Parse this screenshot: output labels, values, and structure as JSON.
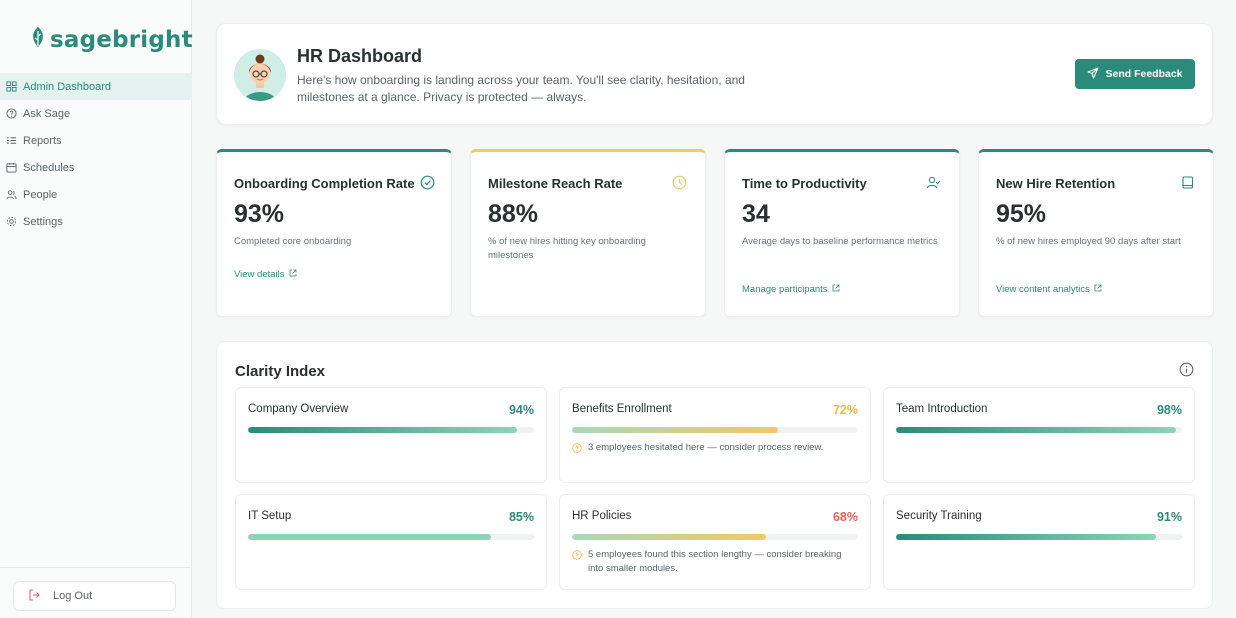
{
  "app": {
    "brand": "sagebright"
  },
  "sidebar": {
    "items": [
      {
        "label": "Admin Dashboard",
        "icon": "grid-icon",
        "active": true
      },
      {
        "label": "Ask Sage",
        "icon": "help-circle-icon",
        "active": false
      },
      {
        "label": "Reports",
        "icon": "list-icon",
        "active": false
      },
      {
        "label": "Schedules",
        "icon": "calendar-icon",
        "active": false
      },
      {
        "label": "People",
        "icon": "users-icon",
        "active": false
      },
      {
        "label": "Settings",
        "icon": "gear-icon",
        "active": false
      }
    ],
    "logout_label": "Log Out"
  },
  "header": {
    "title": "HR Dashboard",
    "subtitle": "Here's how onboarding is landing across your team. You'll see clarity, hesitation, and milestones at a glance. Privacy is protected — always.",
    "feedback_label": "Send Feedback"
  },
  "metrics": [
    {
      "title": "Onboarding Completion Rate",
      "value": "93%",
      "desc": "Completed core onboarding",
      "link": "View details",
      "icon": "check-circle-icon",
      "accent": "#2b8b7a"
    },
    {
      "title": "Milestone Reach Rate",
      "value": "88%",
      "desc": "% of new hires hitting key onboarding milestones",
      "link": "",
      "icon": "clock-icon",
      "accent": "#f3c867"
    },
    {
      "title": "Time to Productivity",
      "value": "34",
      "desc": "Average days to baseline performance metrics",
      "link": "Manage participants",
      "icon": "user-check-icon",
      "accent": "#2b8b7a"
    },
    {
      "title": "New Hire Retention",
      "value": "95%",
      "desc": "% of new hires employed 90 days after start",
      "link": "View content analytics",
      "icon": "book-icon",
      "accent": "#2b8b7a"
    }
  ],
  "clarity": {
    "title": "Clarity Index",
    "items": [
      {
        "name": "Company Overview",
        "pct": "94%",
        "value": 0.94,
        "color": "#2b8b7a",
        "pct_color": "#2b8b7a",
        "note": ""
      },
      {
        "name": "Benefits Enrollment",
        "pct": "72%",
        "value": 0.72,
        "color": "#f3c867",
        "pct_color": "#f0b84a",
        "note": "3 employees hesitated here — consider process review."
      },
      {
        "name": "Team Introduction",
        "pct": "98%",
        "value": 0.98,
        "color": "#2b8b7a",
        "pct_color": "#2b8b7a",
        "note": ""
      },
      {
        "name": "IT Setup",
        "pct": "85%",
        "value": 0.85,
        "color": "#8fd3b6",
        "pct_color": "#2b8b7a",
        "note": ""
      },
      {
        "name": "HR Policies",
        "pct": "68%",
        "value": 0.68,
        "color": "#f3c867",
        "pct_color": "#e8605a",
        "note": "5 employees found this section lengthy — consider breaking into smaller modules."
      },
      {
        "name": "Security Training",
        "pct": "91%",
        "value": 0.91,
        "color": "#2b8b7a",
        "pct_color": "#2b8b7a",
        "note": ""
      }
    ]
  }
}
